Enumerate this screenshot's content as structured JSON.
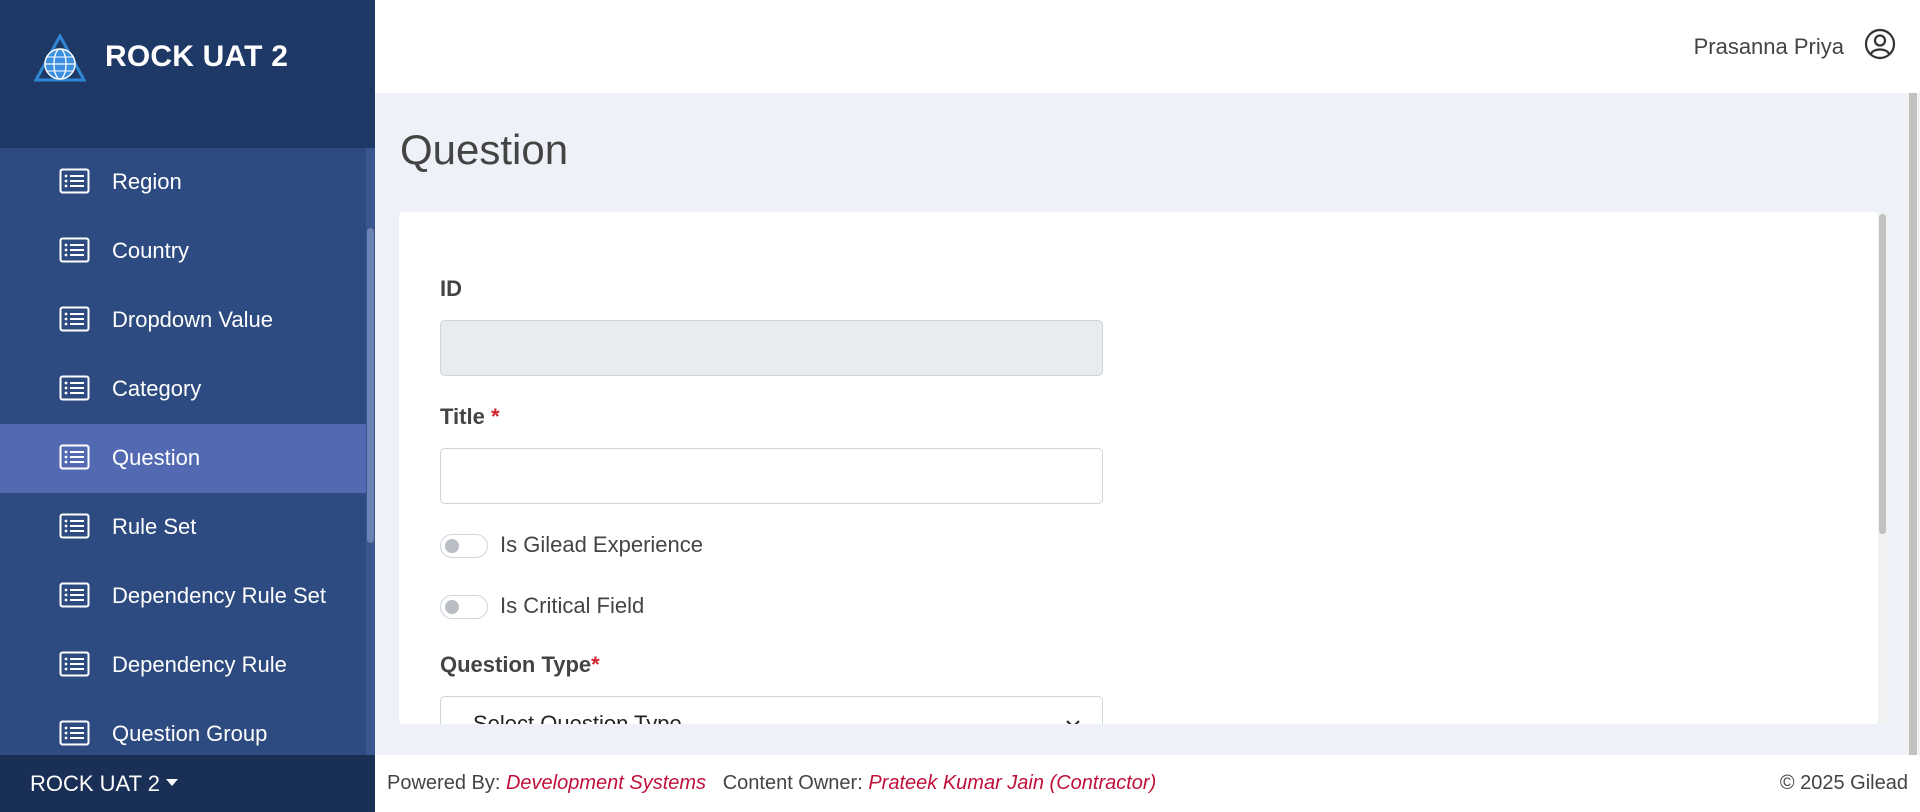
{
  "app": {
    "brand_title": "ROCK UAT 2",
    "environment_label": "ROCK UAT 2"
  },
  "header": {
    "user_name": "Prasanna Priya"
  },
  "sidebar": {
    "items": [
      {
        "label": "Region",
        "icon": "list-icon",
        "active": false
      },
      {
        "label": "Country",
        "icon": "list-icon",
        "active": false
      },
      {
        "label": "Dropdown Value",
        "icon": "list-icon",
        "active": false
      },
      {
        "label": "Category",
        "icon": "list-icon",
        "active": false
      },
      {
        "label": "Question",
        "icon": "list-icon",
        "active": true
      },
      {
        "label": "Rule Set",
        "icon": "list-icon",
        "active": false
      },
      {
        "label": "Dependency Rule Set",
        "icon": "list-icon",
        "active": false
      },
      {
        "label": "Dependency Rule",
        "icon": "list-icon",
        "active": false
      },
      {
        "label": "Question Group",
        "icon": "list-icon",
        "active": false
      }
    ]
  },
  "main": {
    "page_title": "Question",
    "form": {
      "id_label": "ID",
      "id_value": "",
      "title_label": "Title",
      "title_required_mark": "*",
      "title_value": "",
      "toggle_gilead_label": "Is Gilead Experience",
      "toggle_gilead_on": false,
      "toggle_critical_label": "Is Critical Field",
      "toggle_critical_on": false,
      "question_type_label": "Question Type",
      "question_type_required_mark": "*",
      "question_type_selected": "Select Question Type"
    }
  },
  "footer": {
    "powered_by_label": "Powered By:",
    "powered_by_value": "Development Systems",
    "content_owner_label": "Content Owner:",
    "content_owner_value": "Prateek Kumar Jain (Contractor)",
    "copyright": "© 2025 Gilead"
  },
  "colors": {
    "sidebar_bg": "#2d4b80",
    "brand_bg": "#1f3966",
    "active_item": "#536ab3",
    "link_red": "#c0103a",
    "required_red": "#d2222d"
  }
}
